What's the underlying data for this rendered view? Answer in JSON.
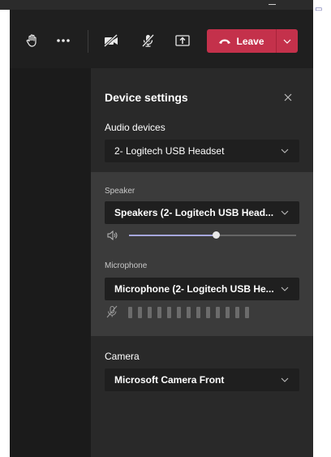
{
  "toolbar": {
    "raise_hand_icon": "raise-hand-icon",
    "more_icon": "more-actions-icon",
    "camera_icon": "camera-off-icon",
    "mic_icon": "mic-off-icon",
    "share_icon": "share-screen-icon",
    "leave_label": "Leave",
    "leave_color": "#c4314b"
  },
  "panel": {
    "title": "Device settings",
    "audio_section": "Audio devices",
    "audio_device": "2- Logitech USB Headset",
    "speaker_label": "Speaker",
    "speaker_device": "Speakers (2- Logitech USB Head...",
    "speaker_volume_fraction": 0.52,
    "microphone_label": "Microphone",
    "microphone_device": "Microphone (2- Logitech USB He...",
    "mic_meter_bars": 13,
    "camera_section": "Camera",
    "camera_device": "Microsoft Camera Front"
  },
  "colors": {
    "panel_bg": "#292929",
    "speaker_block_bg": "#3b3b3b",
    "slider_fill": "#a6a7dc",
    "accent": "#6264a7"
  }
}
